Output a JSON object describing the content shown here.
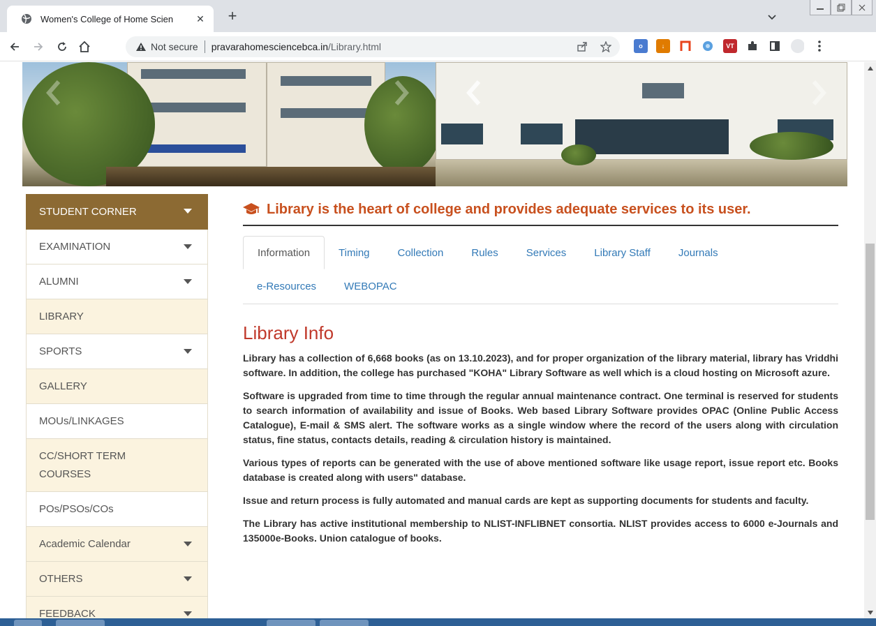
{
  "browser": {
    "tab_title": "Women's College of Home Scien",
    "tab_close": "✕",
    "new_tab": "+",
    "security_label": "Not secure",
    "url_host": "pravarahomesciencebca.in",
    "url_path": "/Library.html"
  },
  "extensions": [
    {
      "name": "ext-1",
      "color": "#4a7bd0",
      "label": "o"
    },
    {
      "name": "ext-2",
      "color": "#e07b00",
      "label": "↓"
    },
    {
      "name": "ext-3",
      "color": "#ffffff",
      "label": ""
    },
    {
      "name": "ext-4",
      "color": "#5aa0e0",
      "label": ""
    },
    {
      "name": "ext-5",
      "color": "#c0282d",
      "label": "VT"
    }
  ],
  "sidebar": {
    "items": [
      {
        "label": "STUDENT CORNER",
        "style": "head",
        "caret": true
      },
      {
        "label": "EXAMINATION",
        "style": "plain",
        "caret": true
      },
      {
        "label": "ALUMNI",
        "style": "plain",
        "caret": true
      },
      {
        "label": "LIBRARY",
        "style": "alt",
        "caret": false
      },
      {
        "label": "SPORTS",
        "style": "plain",
        "caret": true
      },
      {
        "label": "GALLERY",
        "style": "alt",
        "caret": false
      },
      {
        "label": "MOUs/LINKAGES",
        "style": "plain",
        "caret": false
      },
      {
        "label": "CC/SHORT TERM COURSES",
        "style": "alt",
        "caret": false
      },
      {
        "label": "POs/PSOs/COs",
        "style": "plain",
        "caret": false
      },
      {
        "label": "Academic Calendar",
        "style": "alt",
        "caret": true
      },
      {
        "label": "OTHERS",
        "style": "alt",
        "caret": true
      },
      {
        "label": "FEEDBACK",
        "style": "alt",
        "caret": true
      }
    ]
  },
  "content": {
    "heading": "Library is the heart of college and provides adequate services to its user.",
    "tabs_row1": [
      "Information",
      "Timing",
      "Collection",
      "Rules",
      "Services",
      "Library Staff",
      "Journals"
    ],
    "tabs_row2": [
      "e-Resources",
      "WEBOPAC"
    ],
    "active_tab": "Information",
    "section_title": "Library Info",
    "paragraphs": [
      "Library has a collection of 6,668 books (as on 13.10.2023), and for proper organization of the library material, library has Vriddhi software. In addition, the college has purchased \"KOHA\" Library Software as well which is a cloud hosting on Microsoft azure.",
      "Software is upgraded from time to time through the regular annual maintenance contract. One terminal is reserved for students to search information of availability and issue of Books. Web based Library Software provides OPAC (Online Public Access Catalogue), E-mail & SMS alert. The software works as a single window where the record of the users along with circulation status, fine status, contacts details, reading & circulation history is maintained.",
      "Various types of reports can be generated with the use of above mentioned software like usage report, issue report etc. Books database is created along with users\" database.",
      "Issue and return process is fully automated and manual cards are kept as supporting documents for students and faculty.",
      "The Library has active institutional membership to NLIST-INFLIBNET consortia. NLIST provides access to 6000 e-Journals and 135000e-Books. Union catalogue of books."
    ]
  },
  "colors": {
    "accent_brown": "#8c6a33",
    "heading_orange": "#c8501e",
    "title_red": "#c0392b",
    "link_blue": "#337ab7"
  }
}
